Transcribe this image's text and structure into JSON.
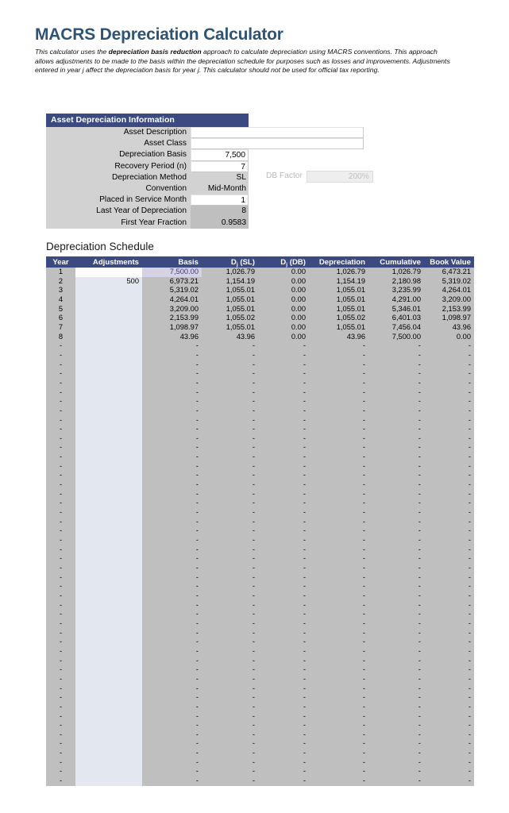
{
  "page": {
    "title": "MACRS Depreciation Calculator",
    "intro_part1": "This calculator uses the ",
    "intro_emphasis": "depreciation basis reduction",
    "intro_part2": " approach to calculate depreciation using MACRS conventions. This approach allows adjustments to be made to the basis within the depreciation schedule for purposes such as losses and improvements. Adjustments entered in year j affect the depreciation basis for year j. This calculator should not be used for official tax reporting."
  },
  "colors": {
    "header_blue": "#3b4a80",
    "title_blue": "#2e5374",
    "panel_grey": "#d2d2d2",
    "locked_grey": "#bfbfbf",
    "adjust_blue": "#e2e7f0",
    "input_basis_lavender": "#d6d2e4"
  },
  "info_panel": {
    "header": "Asset Depreciation Information",
    "rows": [
      {
        "label": "Asset Description",
        "value": "",
        "kind": "input-wide"
      },
      {
        "label": "Asset Class",
        "value": "",
        "kind": "input-wide"
      },
      {
        "label": "Depreciation Basis",
        "value": "7,500",
        "kind": "input"
      },
      {
        "label": "Recovery Period (n)",
        "value": "7",
        "kind": "input"
      },
      {
        "label": "Depreciation Method",
        "value": "SL",
        "kind": "dropdown"
      },
      {
        "label": "Convention",
        "value": "Mid-Month",
        "kind": "dropdown"
      },
      {
        "label": "Placed in Service Month",
        "value": "1",
        "kind": "input"
      },
      {
        "label": "Last Year of Depreciation",
        "value": "8",
        "kind": "locked"
      },
      {
        "label": "First Year Fraction",
        "value": "0.9583",
        "kind": "locked"
      }
    ],
    "db_factor": {
      "label": "DB Factor",
      "value": "200%"
    }
  },
  "schedule": {
    "title": "Depreciation Schedule",
    "columns": [
      {
        "key": "year",
        "label": "Year",
        "sub": ""
      },
      {
        "key": "adjustments",
        "label": "Adjustments",
        "sub": ""
      },
      {
        "key": "basis",
        "label": "Basis",
        "sub": ""
      },
      {
        "key": "d_sl",
        "label": "D",
        "sub": "j",
        "tail": " (SL)"
      },
      {
        "key": "d_db",
        "label": "D",
        "sub": "j",
        "tail": " (DB)"
      },
      {
        "key": "depreciation",
        "label": "Depreciation",
        "sub": ""
      },
      {
        "key": "cumulative",
        "label": "Cumulative",
        "sub": ""
      },
      {
        "key": "book_value",
        "label": "Book Value",
        "sub": ""
      }
    ],
    "empty_marker": "-",
    "total_rows": 56,
    "rows": [
      {
        "year": "1",
        "adjustments": "",
        "basis": "7,500.00",
        "d_sl": "1,026.79",
        "d_db": "0.00",
        "depreciation": "1,026.79",
        "cumulative": "1,026.79",
        "book_value": "6,473.21"
      },
      {
        "year": "2",
        "adjustments": "500",
        "basis": "6,973.21",
        "d_sl": "1,154.19",
        "d_db": "0.00",
        "depreciation": "1,154.19",
        "cumulative": "2,180.98",
        "book_value": "5,319.02"
      },
      {
        "year": "3",
        "adjustments": "",
        "basis": "5,319.02",
        "d_sl": "1,055.01",
        "d_db": "0.00",
        "depreciation": "1,055.01",
        "cumulative": "3,235.99",
        "book_value": "4,264.01"
      },
      {
        "year": "4",
        "adjustments": "",
        "basis": "4,264.01",
        "d_sl": "1,055.01",
        "d_db": "0.00",
        "depreciation": "1,055.01",
        "cumulative": "4,291.00",
        "book_value": "3,209.00"
      },
      {
        "year": "5",
        "adjustments": "",
        "basis": "3,209.00",
        "d_sl": "1,055.01",
        "d_db": "0.00",
        "depreciation": "1,055.01",
        "cumulative": "5,346.01",
        "book_value": "2,153.99"
      },
      {
        "year": "6",
        "adjustments": "",
        "basis": "2,153.99",
        "d_sl": "1,055.02",
        "d_db": "0.00",
        "depreciation": "1,055.02",
        "cumulative": "6,401.03",
        "book_value": "1,098.97"
      },
      {
        "year": "7",
        "adjustments": "",
        "basis": "1,098.97",
        "d_sl": "1,055.01",
        "d_db": "0.00",
        "depreciation": "1,055.01",
        "cumulative": "7,456.04",
        "book_value": "43.96"
      },
      {
        "year": "8",
        "adjustments": "",
        "basis": "43.96",
        "d_sl": "43.96",
        "d_db": "0.00",
        "depreciation": "43.96",
        "cumulative": "7,500.00",
        "book_value": "0.00"
      }
    ]
  }
}
